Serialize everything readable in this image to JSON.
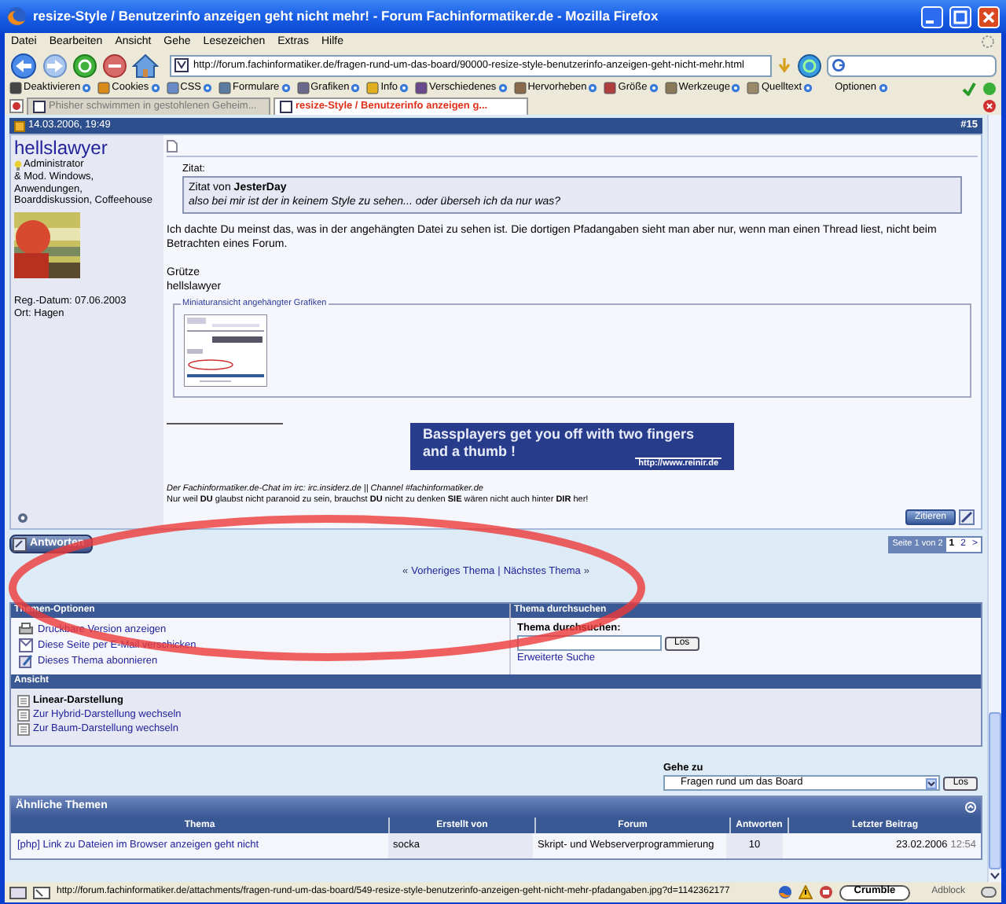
{
  "window": {
    "title": "resize-Style / Benutzerinfo anzeigen geht nicht mehr! - Forum Fachinformatiker.de - Mozilla Firefox"
  },
  "menu_bar": [
    "Datei",
    "Bearbeiten",
    "Ansicht",
    "Gehe",
    "Lesezeichen",
    "Extras",
    "Hilfe"
  ],
  "address_bar": {
    "value": "http://forum.fachinformatiker.de/fragen-rund-um-das-board/90000-resize-style-benutzerinfo-anzeigen-geht-nicht-mehr.html"
  },
  "dev_toolbar": [
    "Deaktivieren",
    "Cookies",
    "CSS",
    "Formulare",
    "Grafiken",
    "Info",
    "Verschiedenes",
    "Hervorheben",
    "Größe",
    "Werkzeuge",
    "Quelltext",
    "Optionen"
  ],
  "tabs": [
    {
      "label": "Phisher schwimmen in gestohlenen Geheim...",
      "selected": false
    },
    {
      "label": "resize-Style / Benutzerinfo anzeigen g...",
      "selected": true
    }
  ],
  "post": {
    "date": "14.03.2006, 19:49",
    "number": "#15",
    "author": {
      "name": "hellslawyer",
      "rank": "Administrator",
      "roles": "& Mod. Windows, Anwendungen, Boarddiskussion, Coffeehouse",
      "reg_date": "Reg.-Datum: 07.06.2003",
      "location": "Ort: Hagen"
    },
    "quote": {
      "label": "Zitat:",
      "byline": "Zitat von **JesterDay**",
      "text": "also bei mir ist der in keinem Style zu sehen... oder überseh ich da nur was?"
    },
    "paragraph": "Ich dachte Du meinst das, was in der angehängten Datei zu sehen ist. Die dortigen Pfadangaben sieht man aber nur, wenn man einen Thread liest, nicht beim Betrachten eines Forum.",
    "closing": [
      "Grütze",
      "hellslawyer"
    ],
    "attachments": {
      "legend": "Miniaturansicht angehängter Grafiken"
    },
    "banner": {
      "slogan": "Bassplayers get you off with two fingers and a thumb !",
      "url": "http://www.reinir.de"
    },
    "signature": {
      "chat_line": "Der Fachinformatiker.de-Chat im irc: irc.insiderz.de || Channel #fachinformatiker.de",
      "quote_line": "Nur weil **DU** glaubst nicht paranoid zu sein, brauchst **DU** nicht zu denken **SIE** wären nicht auch hinter **DIR** her!"
    },
    "quote_button": "Zitieren"
  },
  "reply_button": "Antworten",
  "pagination": {
    "label": "Seite 1 von 2",
    "pages": [
      {
        "label": "1",
        "selected": true
      },
      {
        "label": "2",
        "selected": false
      }
    ],
    "next": ">"
  },
  "thread_nav": {
    "prev_arrow": "«",
    "prev": "Vorheriges Thema",
    "separator": "|",
    "next": "Nächstes Thema",
    "next_arrow": "»"
  },
  "thread_options": {
    "title": "Themen-Optionen",
    "items": [
      "Druckbare Version anzeigen",
      "Diese Seite per E-Mail verschicken",
      "Dieses Thema abonnieren"
    ]
  },
  "thread_search": {
    "title": "Thema durchsuchen",
    "label": "Thema durchsuchen:",
    "button": "Los",
    "advanced": "Erweiterte Suche"
  },
  "view": {
    "title": "Ansicht",
    "items": [
      {
        "label": "Linear-Darstellung",
        "selected": true
      },
      {
        "label": "Zur Hybrid-Darstellung wechseln",
        "selected": false
      },
      {
        "label": "Zur Baum-Darstellung wechseln",
        "selected": false
      }
    ]
  },
  "goto": {
    "label": "Gehe zu",
    "value": "Fragen rund um das Board",
    "button": "Los"
  },
  "similar": {
    "title": "Ähnliche Themen",
    "columns": [
      "Thema",
      "Erstellt von",
      "Forum",
      "Antworten",
      "Letzter Beitrag"
    ],
    "rows": [
      {
        "topic": "[php] Link zu Dateien im Browser anzeigen geht nicht",
        "author": "socka",
        "forum": "Skript- und Webserverprogrammierung",
        "replies": "10",
        "date": "23.02.2006",
        "time": "12:54"
      }
    ]
  },
  "status_bar": {
    "url": "http://forum.fachinformatiker.de/attachments/fragen-rund-um-das-board/549-resize-style-benutzerinfo-anzeigen-geht-nicht-mehr-pfadangaben.jpg?d=1142362177",
    "crumble": "Crumble",
    "adblock": "Adblock"
  }
}
